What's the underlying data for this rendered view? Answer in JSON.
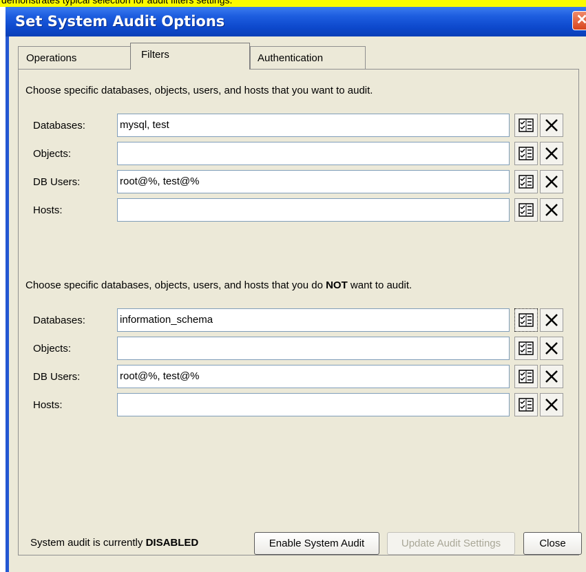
{
  "caption": "demonstrates typical selection for audit filters settings.",
  "window": {
    "title": "Set System Audit Options",
    "close_glyph": "✕"
  },
  "tabs": [
    {
      "label": "Operations",
      "active": false
    },
    {
      "label": "Filters",
      "active": true
    },
    {
      "label": "Authentication",
      "active": false
    }
  ],
  "include": {
    "intro": "Choose specific databases, objects, users, and hosts that you want to audit.",
    "rows": [
      {
        "label": "Databases:",
        "value": "mysql, test"
      },
      {
        "label": "Objects:",
        "value": ""
      },
      {
        "label": "DB Users:",
        "value": "root@%, test@%"
      },
      {
        "label": "Hosts:",
        "value": ""
      }
    ]
  },
  "exclude": {
    "intro_before": "Choose specific databases, objects, users, and hosts that you do ",
    "intro_emphasis": "NOT",
    "intro_after": " want to audit.",
    "rows": [
      {
        "label": "Databases:",
        "value": "information_schema"
      },
      {
        "label": "Objects:",
        "value": ""
      },
      {
        "label": "DB Users:",
        "value": "root@%, test@%"
      },
      {
        "label": "Hosts:",
        "value": ""
      }
    ]
  },
  "row_buttons": {
    "select_icon": "checklist-icon",
    "clear_icon": "clear-x-icon"
  },
  "footer": {
    "status_prefix": "System audit is currently ",
    "status_value": "DISABLED",
    "enable_label": "Enable System Audit",
    "update_label": "Update Audit Settings",
    "close_label": "Close"
  },
  "colors": {
    "titlebar": "#0d48cc",
    "dialog_bg": "#ece9d8",
    "caption_highlight": "#fbfb00"
  }
}
